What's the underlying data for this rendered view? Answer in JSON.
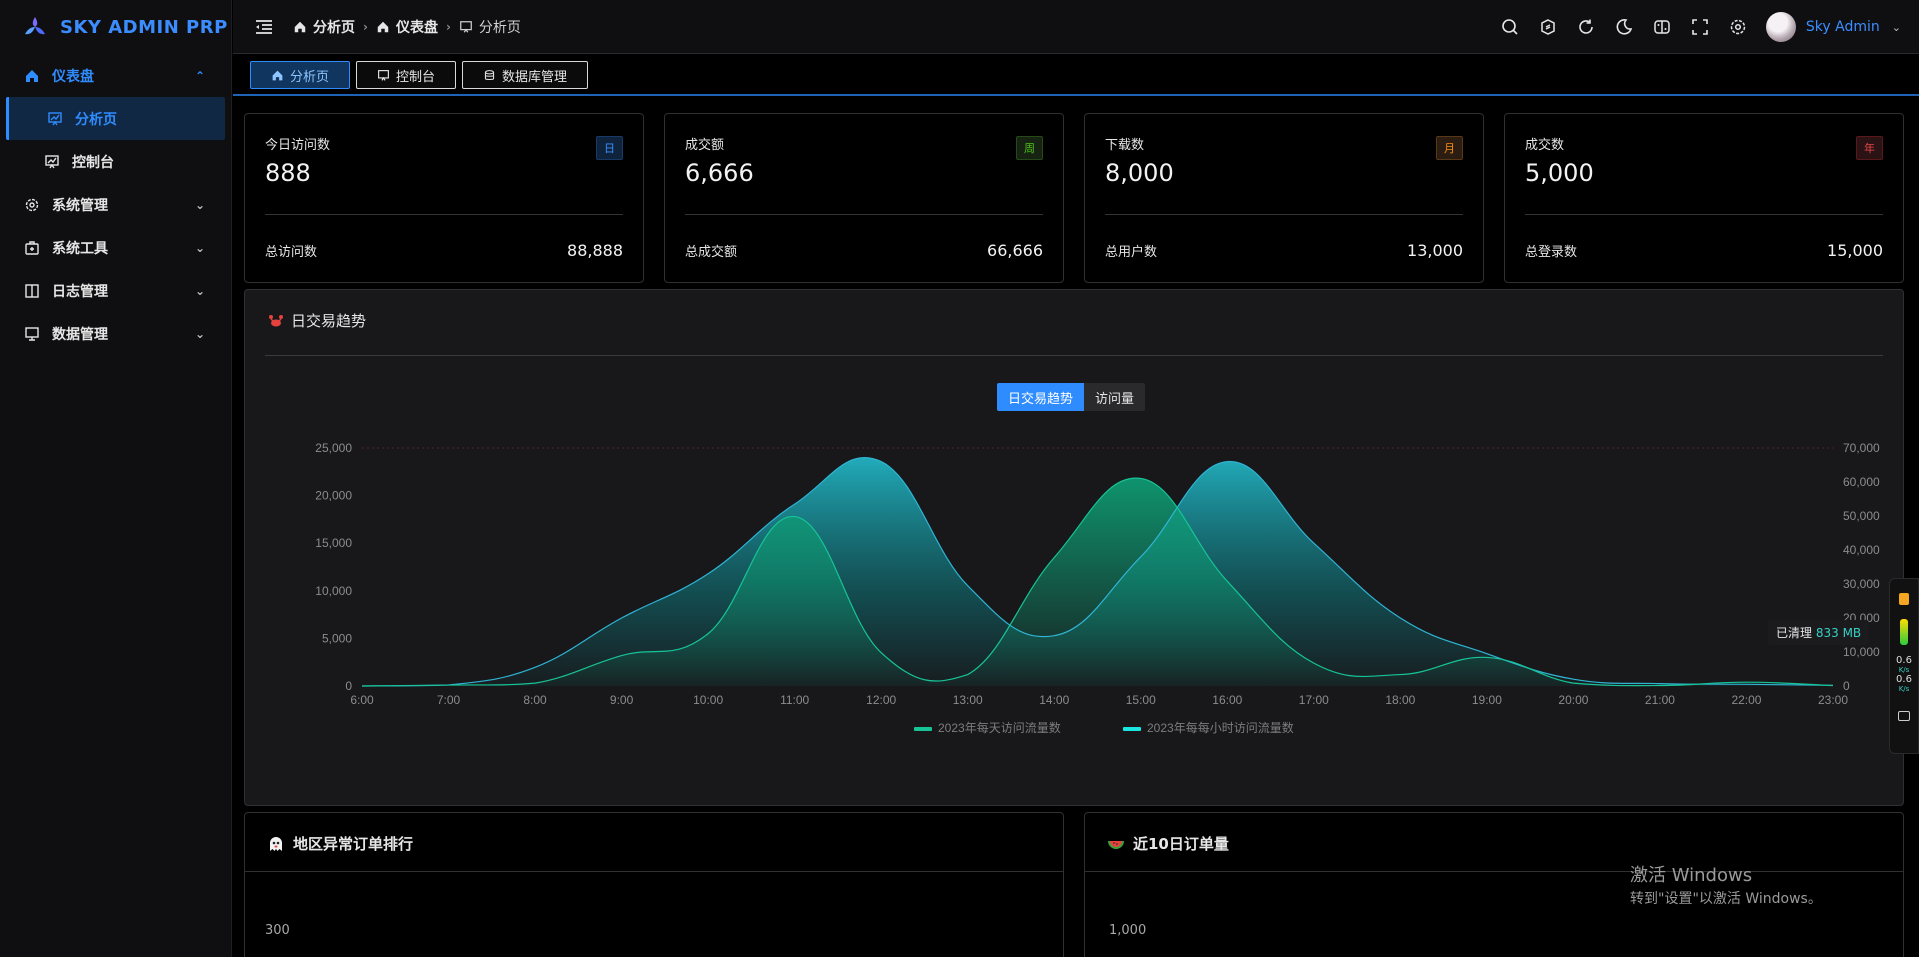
{
  "app": {
    "title": "SKY ADMIN PRP"
  },
  "sidebar": {
    "items": [
      {
        "label": "仪表盘",
        "icon": "home-icon",
        "open": true,
        "children": [
          {
            "label": "分析页",
            "icon": "presentation-icon",
            "active": true
          },
          {
            "label": "控制台",
            "icon": "presentation-icon",
            "active": false
          }
        ]
      },
      {
        "label": "系统管理",
        "icon": "gear-icon"
      },
      {
        "label": "系统工具",
        "icon": "toolbox-icon"
      },
      {
        "label": "日志管理",
        "icon": "book-icon"
      },
      {
        "label": "数据管理",
        "icon": "monitor-icon"
      }
    ]
  },
  "header": {
    "breadcrumb": [
      "分析页",
      "仪表盘",
      "分析页"
    ],
    "user_name": "Sky Admin"
  },
  "tabs": [
    {
      "label": "分析页",
      "icon": "home-icon",
      "active": true
    },
    {
      "label": "控制台",
      "icon": "presentation-icon",
      "active": false
    },
    {
      "label": "数据库管理",
      "icon": "database-icon",
      "active": false
    }
  ],
  "cards": [
    {
      "title": "今日访问数",
      "value": "888",
      "badge": "日",
      "badge_color": "#3b8dff",
      "badge_bg": "#10233d",
      "foot_label": "总访问数",
      "foot_value": "88,888"
    },
    {
      "title": "成交额",
      "value": "6,666",
      "badge": "周",
      "badge_color": "#52c41a",
      "badge_bg": "#162312",
      "foot_label": "总成交额",
      "foot_value": "66,666"
    },
    {
      "title": "下载数",
      "value": "8,000",
      "badge": "月",
      "badge_color": "#fa8c16",
      "badge_bg": "#2b1d11",
      "foot_label": "总用户数",
      "foot_value": "13,000"
    },
    {
      "title": "成交数",
      "value": "5,000",
      "badge": "年",
      "badge_color": "#e84749",
      "badge_bg": "#2a1215",
      "foot_label": "总登录数",
      "foot_value": "15,000"
    }
  ],
  "trend_panel": {
    "title": "日交易趋势",
    "toggle": [
      "日交易趋势",
      "访问量"
    ],
    "toggle_active": 0
  },
  "chart_data": {
    "type": "area",
    "x": [
      "6:00",
      "7:00",
      "8:00",
      "9:00",
      "10:00",
      "11:00",
      "12:00",
      "13:00",
      "14:00",
      "15:00",
      "16:00",
      "17:00",
      "18:00",
      "19:00",
      "20:00",
      "21:00",
      "22:00",
      "23:00"
    ],
    "y_left": {
      "ticks": [
        "0",
        "5,000",
        "10,000",
        "15,000",
        "20,000",
        "25,000"
      ],
      "lim": [
        0,
        25000
      ]
    },
    "y_right": {
      "ticks": [
        "0",
        "10,000",
        "20,000",
        "30,000",
        "40,000",
        "50,000",
        "60,000",
        "70,000"
      ],
      "lim": [
        0,
        70000
      ]
    },
    "series": [
      {
        "name": "2023年每天访问流量数",
        "axis": "left",
        "color": "#17c497",
        "values": [
          0,
          100,
          300,
          3200,
          5500,
          17800,
          3500,
          1200,
          13500,
          21800,
          11000,
          2400,
          1200,
          3000,
          300,
          50,
          400,
          50
        ]
      },
      {
        "name": "2023年每每小时访问流量数",
        "axis": "right",
        "color": "#2fb4d4",
        "values": [
          0,
          300,
          5500,
          20000,
          33000,
          53500,
          66000,
          29500,
          14800,
          38000,
          66000,
          42000,
          20000,
          9500,
          2000,
          700,
          500,
          200
        ]
      }
    ],
    "legend": "bottom-center",
    "grid": false
  },
  "bottom_panels": [
    {
      "title": "地区异常订单排行",
      "icon": "ghost-icon",
      "tick": "300"
    },
    {
      "title": "近10日订单量",
      "icon": "watermelon-icon",
      "tick": "1,000"
    }
  ],
  "overlay": {
    "cleaned_label": "已清理",
    "cleaned_value": "833 MB",
    "speed_a": "0.6",
    "speed_b": "0.6",
    "speed_unit": "K/s"
  },
  "watermark": {
    "line1": "激活 Windows",
    "line2": "转到\"设置\"以激活 Windows。"
  }
}
